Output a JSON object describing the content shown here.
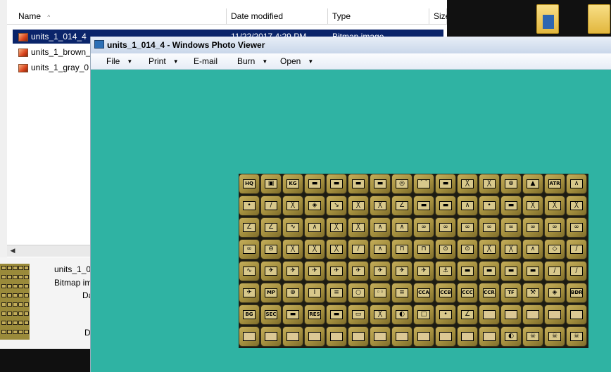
{
  "explorer": {
    "columns": [
      "Name",
      "Date modified",
      "Type",
      "Size"
    ],
    "sort_indicator": "^",
    "files": [
      {
        "name": "units_1_014_4",
        "date": "11/22/2017 4:29 PM",
        "type": "Bitmap image",
        "selected": true
      },
      {
        "name": "units_1_brown_c",
        "date": "",
        "type": "",
        "selected": false
      },
      {
        "name": "units_1_gray_0",
        "date": "",
        "type": "",
        "selected": false
      }
    ],
    "scroll_left_arrow": "◀"
  },
  "details": {
    "name": "units_1_0",
    "type": "Bitmap ima",
    "line3": "Da",
    "line4": "D"
  },
  "viewer": {
    "title": "units_1_014_4 - Windows Photo Viewer",
    "menu": [
      {
        "label": "File",
        "has_dropdown": true
      },
      {
        "label": "Print",
        "has_dropdown": true
      },
      {
        "label": "E-mail",
        "has_dropdown": false
      },
      {
        "label": "Burn",
        "has_dropdown": true
      },
      {
        "label": "Open",
        "has_dropdown": true
      }
    ],
    "dropdown_caret": "▼"
  },
  "sprite_sheet": {
    "rows": [
      [
        "HQ",
        "▣",
        "KG",
        "▬",
        "▬",
        "▬",
        "▬",
        "◎",
        "⌒",
        "▬",
        "╳",
        "╳",
        "⊕",
        "▲",
        "ATR",
        "∧"
      ],
      [
        "•",
        "∕",
        "╳",
        "◈",
        "↘",
        "╳",
        "╳",
        "∠",
        "▬",
        "▬",
        "∧",
        "•",
        "▬",
        "╳",
        "╳",
        "╳"
      ],
      [
        "∠",
        "∠",
        "∿",
        "∧",
        "╳",
        "╳",
        "∧",
        "∧",
        "∞",
        "∞",
        "∞",
        "∞",
        "∞",
        "∞",
        "∞",
        "∞"
      ],
      [
        "∞",
        "⊖",
        "╳",
        "╳",
        "╳",
        "∕",
        "∧",
        "⊓",
        "⊓",
        "⊙",
        "⊙",
        "╳",
        "╳",
        "∧",
        "◇",
        "∕"
      ],
      [
        "∿",
        "✈",
        "✈",
        "✈",
        "✈",
        "✈",
        "✈",
        "✈",
        "✈",
        "⚓",
        "▬",
        "▬",
        "▬",
        "▬",
        "∕",
        "∕"
      ],
      [
        "✈",
        "MP",
        "⊕",
        "I",
        "≡",
        "○",
        "◦◦",
        "≡",
        "CCA",
        "CCB",
        "CCC",
        "CCR",
        "TF",
        "⚒",
        "◈",
        "BDR"
      ],
      [
        "BG",
        "SEC",
        "▬",
        "RES",
        "▬",
        "▭",
        "╳",
        "◐",
        "□",
        "•",
        "∠",
        "",
        "",
        "",
        "",
        ""
      ],
      [
        "",
        "",
        "",
        "",
        "",
        "",
        "",
        "",
        "",
        "",
        "",
        "",
        "◐",
        "☠",
        "☠",
        "☠"
      ]
    ]
  }
}
